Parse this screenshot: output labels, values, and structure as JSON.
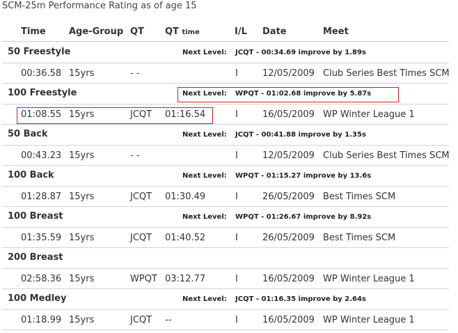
{
  "page": {
    "title": "SCM-25m Performance Rating as of age 15"
  },
  "columns": {
    "time": "Time",
    "age_group": "Age-Group",
    "qt": "QT",
    "qt_time_main": "QT",
    "qt_time_small": "time",
    "il": "I/L",
    "date": "Date",
    "meet": "Meet"
  },
  "next_level_label": "Next Level:",
  "events": [
    {
      "name": "50 Freestyle",
      "next_level": "JCQT - 00:34.69 improve by 1.89s",
      "result": {
        "time": "00:36.58",
        "age_group": "15yrs",
        "qt": "- -",
        "qt_time": "",
        "il": "I",
        "date": "12/05/2009",
        "meet": "Club Series Best Times SCM"
      }
    },
    {
      "name": "100 Freestyle",
      "next_level": "WPQT - 01:02.68 improve by 5.87s",
      "result": {
        "time": "01:08.55",
        "age_group": "15yrs",
        "qt": "JCQT",
        "qt_time": "01:16.54",
        "il": "I",
        "date": "16/05/2009",
        "meet": "WP Winter League 1"
      }
    },
    {
      "name": "50 Back",
      "next_level": "JCQT - 00:41.88 improve by 1.35s",
      "result": {
        "time": "00:43.23",
        "age_group": "15yrs",
        "qt": "- -",
        "qt_time": "",
        "il": "I",
        "date": "12/05/2009",
        "meet": "Club Series Best Times SCM"
      }
    },
    {
      "name": "100 Back",
      "next_level": "WPQT - 01:15.27 improve by 13.6s",
      "result": {
        "time": "01:28.87",
        "age_group": "15yrs",
        "qt": "JCQT",
        "qt_time": "01:30.49",
        "il": "I",
        "date": "26/05/2009",
        "meet": "Best Times SCM"
      }
    },
    {
      "name": "100 Breast",
      "next_level": "WPQT - 01:26.67 improve by 8.92s",
      "result": {
        "time": "01:35.59",
        "age_group": "15yrs",
        "qt": "JCQT",
        "qt_time": "01:40.52",
        "il": "I",
        "date": "26/05/2009",
        "meet": "Best Times SCM"
      }
    },
    {
      "name": "200 Breast",
      "next_level": "",
      "result": {
        "time": "02:58.36",
        "age_group": "15yrs",
        "qt": "WPQT",
        "qt_time": "03:12.77",
        "il": "I",
        "date": "16/05/2009",
        "meet": "WP Winter League 1"
      }
    },
    {
      "name": "100 Medley",
      "next_level": "JCQT - 01:16.35 improve by 2.64s",
      "result": {
        "time": "01:18.99",
        "age_group": "15yrs",
        "qt": "JCQT",
        "qt_time": "--",
        "il": "I",
        "date": "16/05/2009",
        "meet": "WP Winter League 1"
      }
    }
  ],
  "highlight_color": "#d02020"
}
